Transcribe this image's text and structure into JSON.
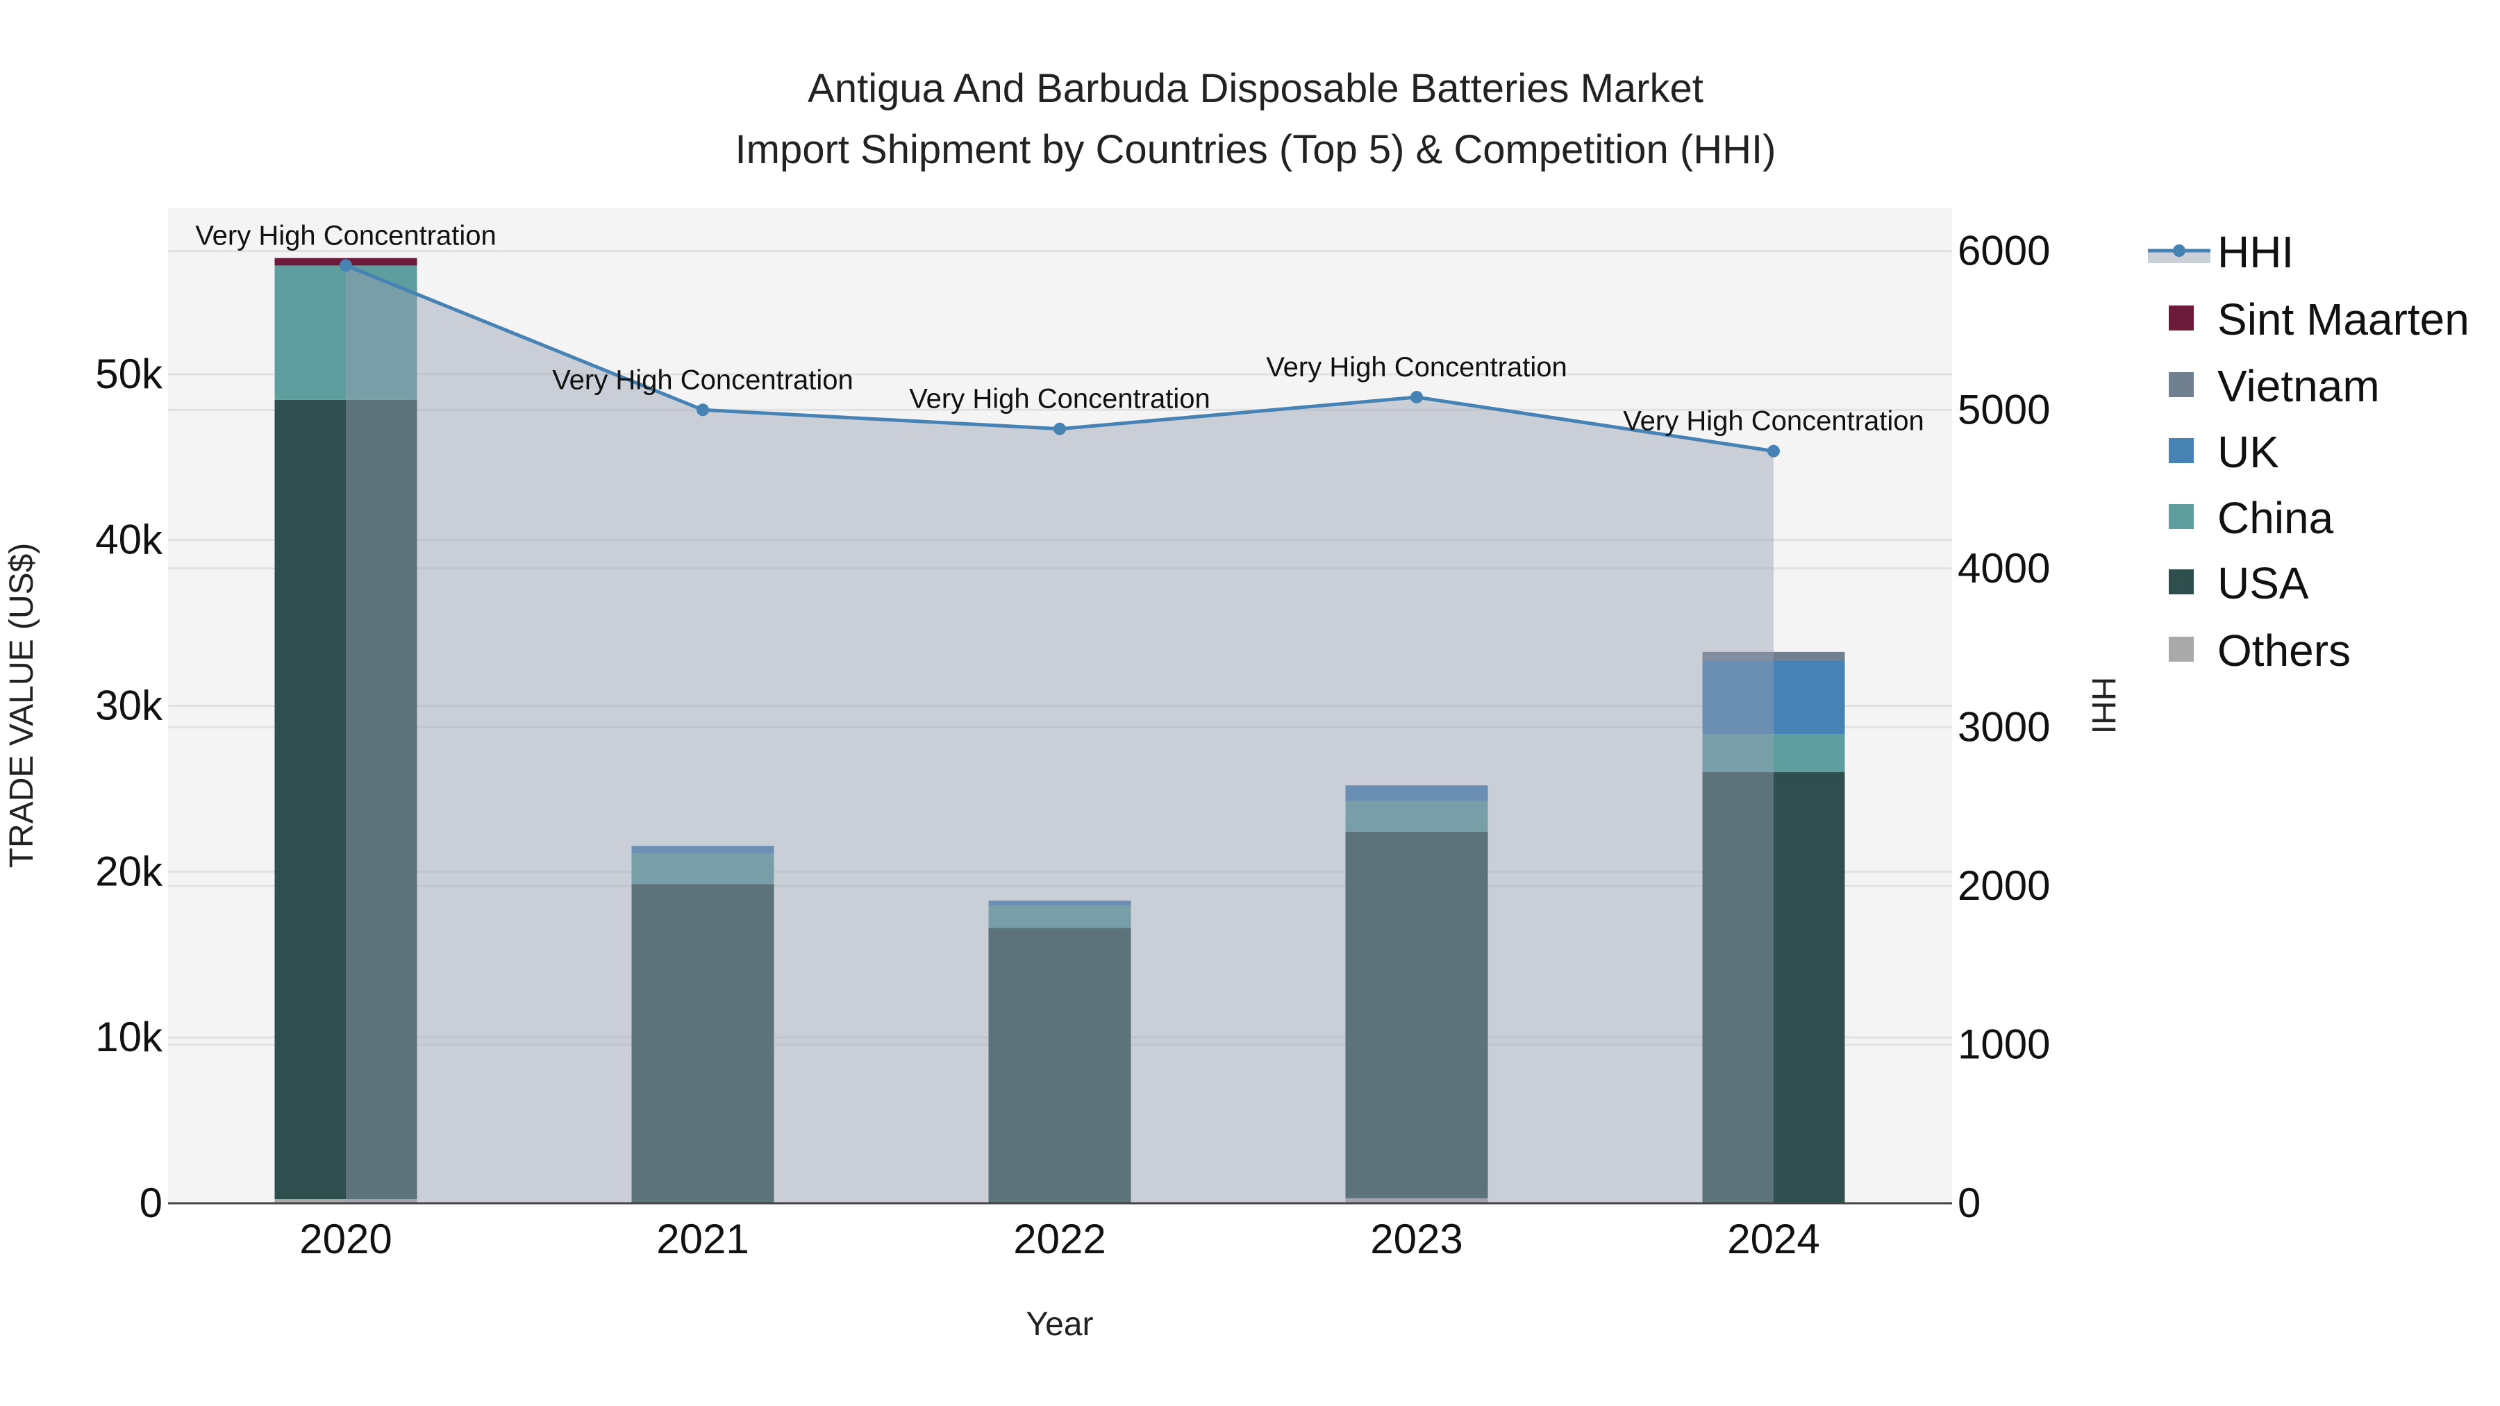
{
  "chart_data": {
    "type": "bar",
    "title": "Antigua And Barbuda Disposable Batteries Market",
    "subtitle": "Import Shipment by Countries (Top 5) & Competition (HHI)",
    "xlabel": "Year",
    "ylabel": "TRADE VALUE (US$)",
    "y2label": "HHI",
    "categories": [
      "2020",
      "2021",
      "2022",
      "2023",
      "2024"
    ],
    "ylim": [
      0,
      60000
    ],
    "y2lim": [
      0,
      6270
    ],
    "yticks": [
      {
        "v": 0,
        "label": "0"
      },
      {
        "v": 10000,
        "label": "10k"
      },
      {
        "v": 20000,
        "label": "20k"
      },
      {
        "v": 30000,
        "label": "30k"
      },
      {
        "v": 40000,
        "label": "40k"
      },
      {
        "v": 50000,
        "label": "50k"
      }
    ],
    "y2ticks": [
      {
        "v": 0,
        "label": "0"
      },
      {
        "v": 1000,
        "label": "1000"
      },
      {
        "v": 2000,
        "label": "2000"
      },
      {
        "v": 3000,
        "label": "3000"
      },
      {
        "v": 4000,
        "label": "4000"
      },
      {
        "v": 5000,
        "label": "5000"
      },
      {
        "v": 6000,
        "label": "6000"
      }
    ],
    "series": [
      {
        "name": "Others",
        "color": "#a9a9a9",
        "values": [
          250,
          0,
          0,
          300,
          0
        ]
      },
      {
        "name": "USA",
        "color": "#2f4f4f",
        "values": [
          48200,
          19250,
          16600,
          22100,
          26000
        ]
      },
      {
        "name": "China",
        "color": "#5f9e9e",
        "values": [
          8100,
          1850,
          1350,
          1850,
          2300
        ]
      },
      {
        "name": "UK",
        "color": "#4682b4",
        "values": [
          0,
          450,
          300,
          950,
          4450
        ]
      },
      {
        "name": "Vietnam",
        "color": "#708090",
        "values": [
          0,
          0,
          0,
          0,
          500
        ]
      },
      {
        "name": "Sint Maarten",
        "color": "#6b1a3a",
        "values": [
          450,
          0,
          0,
          0,
          0
        ]
      }
    ],
    "hhi": {
      "name": "HHI",
      "color": "#4682b4",
      "values": [
        5910,
        5000,
        4880,
        5080,
        4740
      ]
    },
    "annotations": [
      "Very High Concentration",
      "Very High Concentration",
      "Very High Concentration",
      "Very High Concentration",
      "Very High Concentration"
    ],
    "legend_order": [
      "HHI",
      "Sint Maarten",
      "Vietnam",
      "UK",
      "China",
      "USA",
      "Others"
    ],
    "legend_position": "right"
  }
}
